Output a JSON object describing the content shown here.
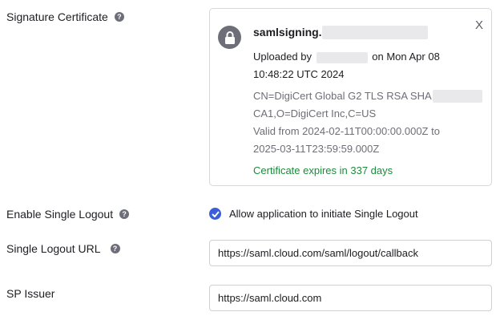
{
  "signature_certificate": {
    "label": "Signature Certificate",
    "help_icon": "help-icon",
    "card": {
      "lock_icon": "lock-icon",
      "close_label": "X",
      "name": "samlsigning.c",
      "uploaded_prefix": "Uploaded by",
      "uploaded_suffix": "on Mon Apr 08",
      "uploaded_time": "10:48:22 UTC 2024",
      "subject_line1": "CN=DigiCert Global G2 TLS RSA SHA",
      "subject_line2": "CA1,O=DigiCert Inc,C=US",
      "valid_line1": "Valid from 2024-02-11T00:00:00.000Z to",
      "valid_line2": "2025-03-11T23:59:59.000Z",
      "expiry": "Certificate expires in 337 days",
      "expiry_color": "#1d8a3c"
    }
  },
  "single_logout": {
    "label": "Enable Single Logout",
    "checked": true,
    "checkbox_label": "Allow application to initiate Single Logout",
    "accent": "#3b5ed8"
  },
  "single_logout_url": {
    "label": "Single Logout URL",
    "value": "https://saml.cloud.com/saml/logout/callback"
  },
  "sp_issuer": {
    "label": "SP Issuer",
    "value": "https://saml.cloud.com"
  }
}
